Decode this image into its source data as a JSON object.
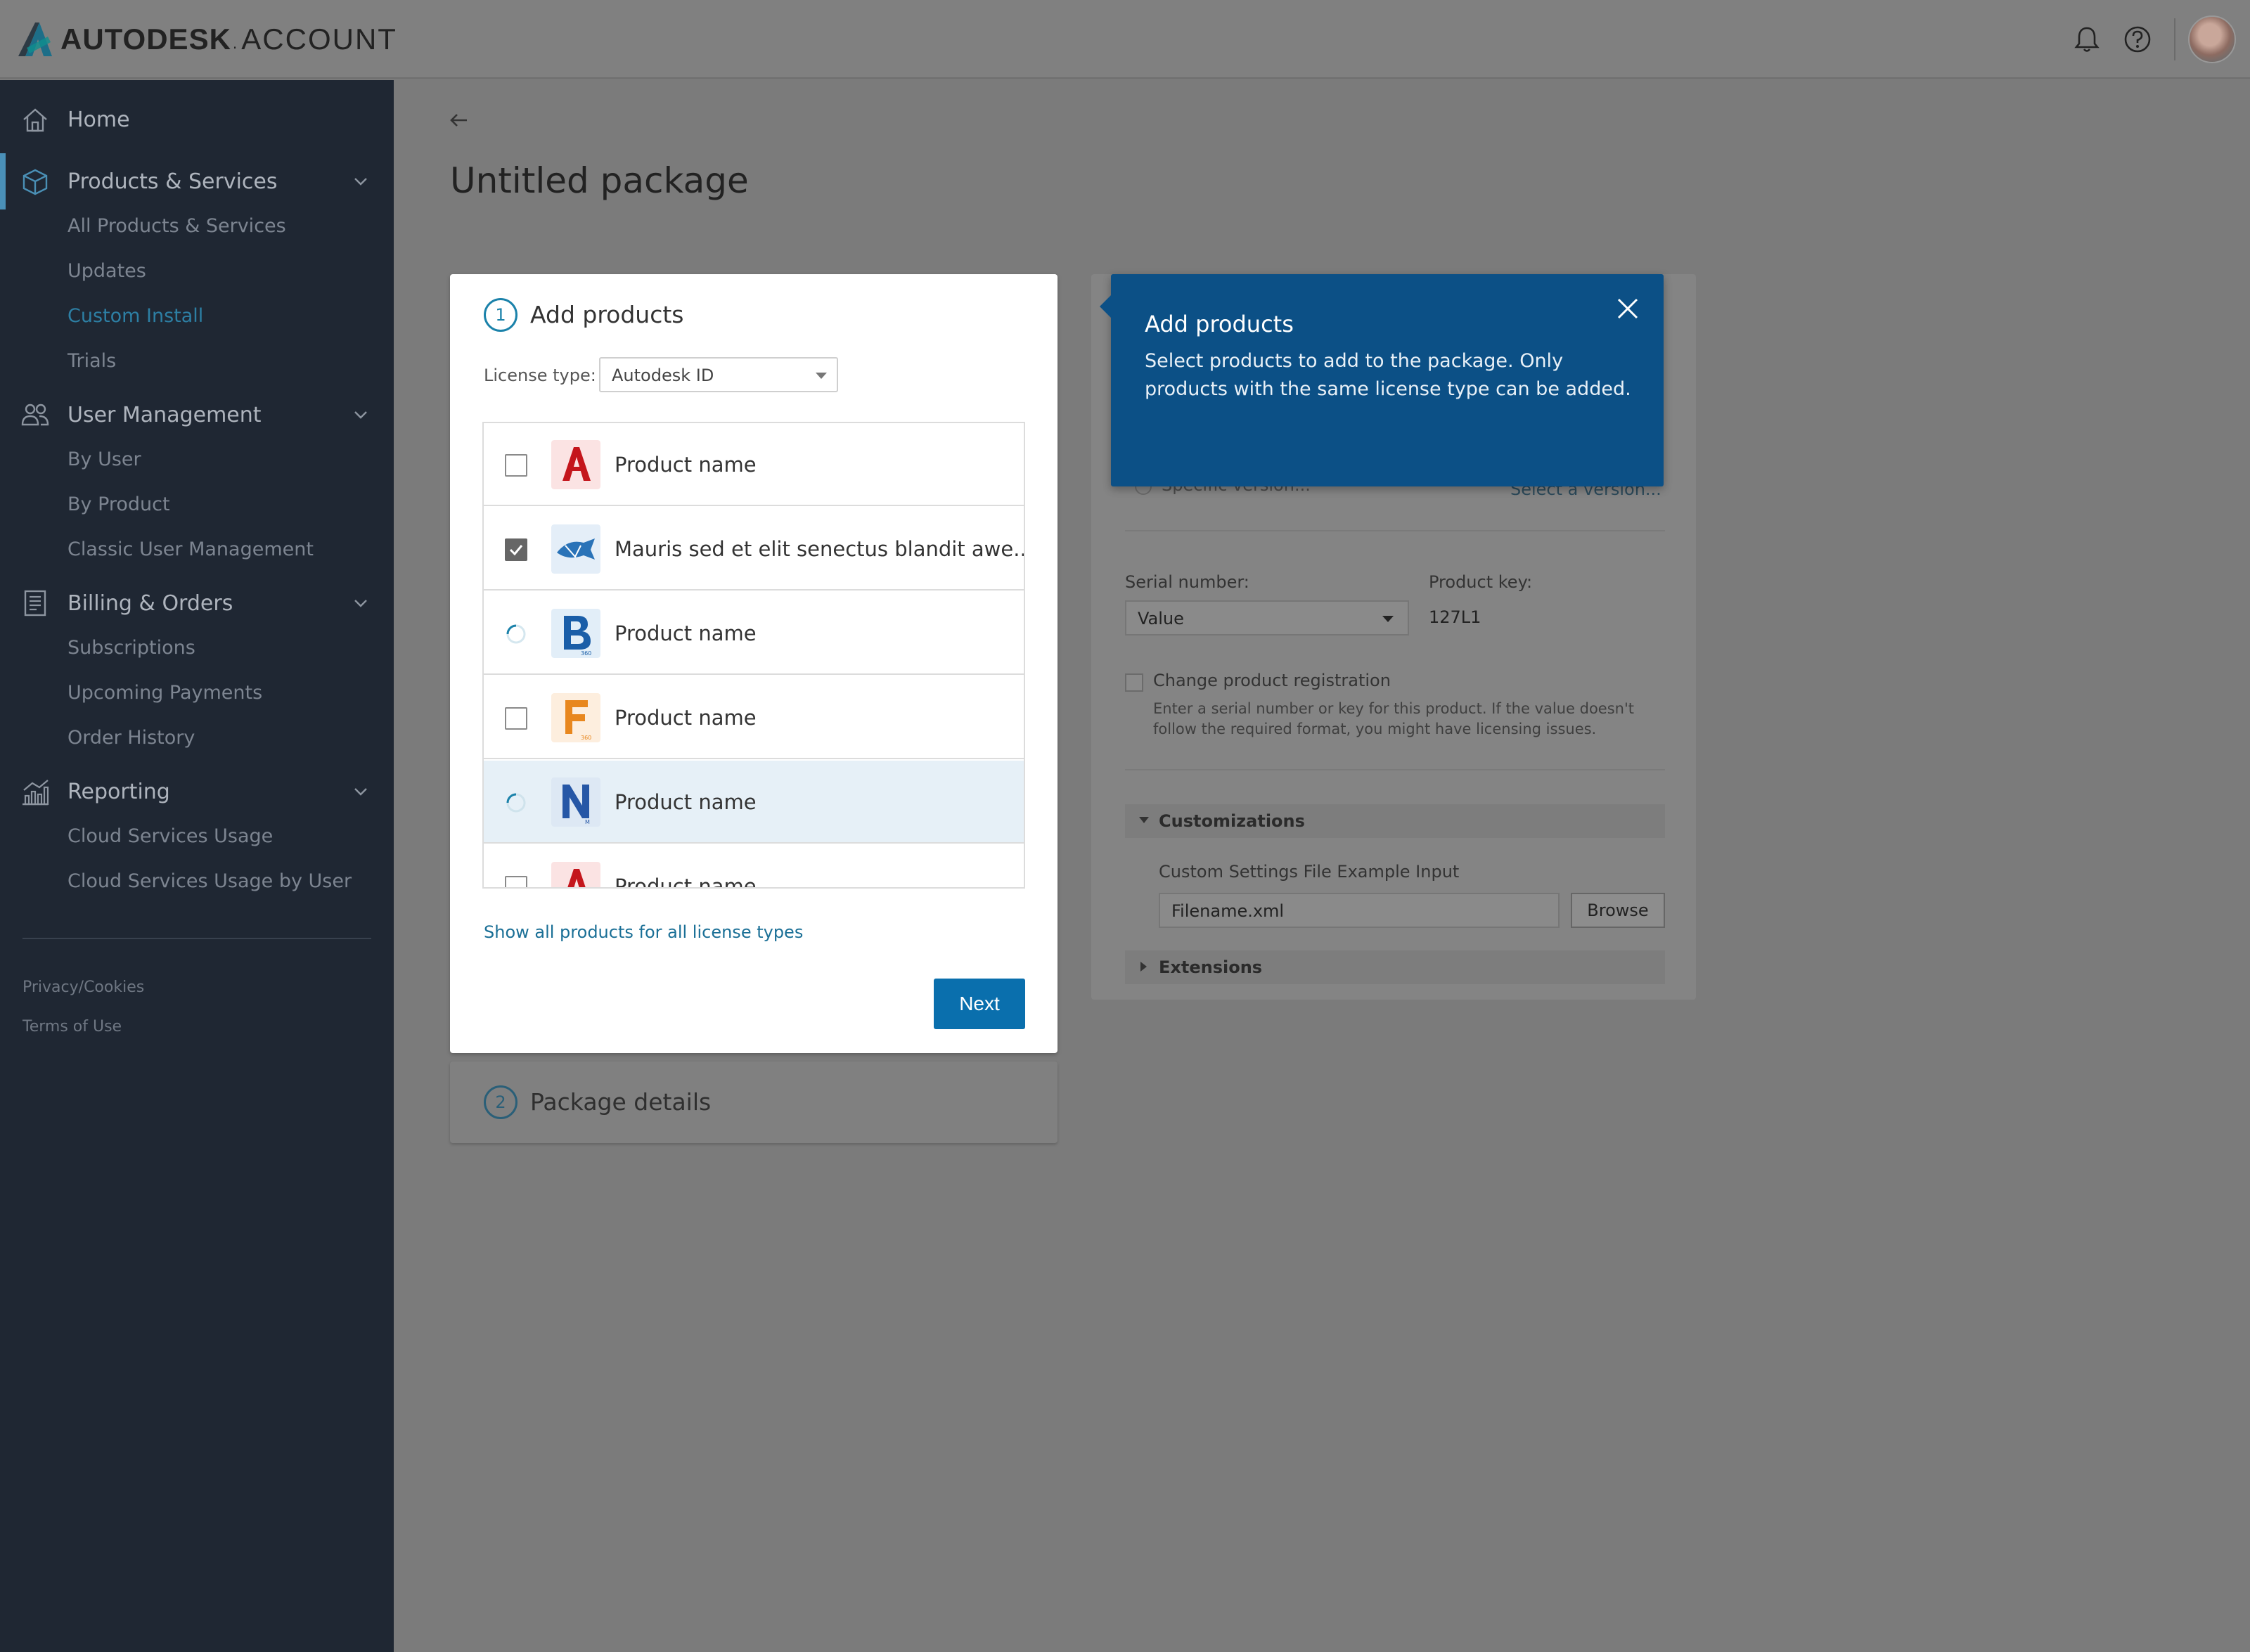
{
  "header": {
    "brand": "AUTODESK",
    "brand_dot": ".",
    "section": "ACCOUNT",
    "icons": [
      "autodesk-logo-icon",
      "bell-icon",
      "help-icon",
      "avatar"
    ]
  },
  "sidebar": {
    "home": "Home",
    "products_services": {
      "label": "Products & Services",
      "items": [
        "All Products & Services",
        "Updates",
        "Custom Install",
        "Trials"
      ],
      "current": "Custom Install"
    },
    "user_management": {
      "label": "User Management",
      "items": [
        "By User",
        "By Product",
        "Classic User Management"
      ]
    },
    "billing_orders": {
      "label": "Billing & Orders",
      "items": [
        "Subscriptions",
        "Upcoming Payments",
        "Order History"
      ]
    },
    "reporting": {
      "label": "Reporting",
      "items": [
        "Cloud Services Usage",
        "Cloud Services Usage by User"
      ]
    },
    "footer": [
      "Privacy/Cookies",
      "Terms of Use"
    ]
  },
  "main": {
    "page_title": "Untitled package",
    "add_products": {
      "step": "1",
      "title": "Add products",
      "license_label": "License type:",
      "license_value": "Autodesk ID",
      "products": [
        {
          "name": "Product name",
          "state": "unchecked",
          "icon": "autocad-icon"
        },
        {
          "name": "Mauris sed et elit senectus blandit awe...",
          "state": "checked",
          "icon": "navisworks-fish-icon"
        },
        {
          "name": "Product name",
          "state": "loading",
          "icon": "bim360-icon"
        },
        {
          "name": "Product name",
          "state": "unchecked",
          "icon": "fusion360-icon"
        },
        {
          "name": "Product name",
          "state": "loading",
          "icon": "navisworks-icon"
        },
        {
          "name": "Product name",
          "state": "unchecked",
          "icon": "autocad-icon"
        }
      ],
      "show_all": "Show all products for all license types",
      "next": "Next"
    },
    "package_details": {
      "step": "2",
      "title": "Package details"
    },
    "details_card": {
      "specific_version": "Specific version...",
      "select_version": "Select a version...",
      "serial_label": "Serial number:",
      "serial_value": "Value",
      "product_key_label": "Product key:",
      "product_key_value": "127L1",
      "change_registration": "Change product registration",
      "change_registration_help": "Enter a serial number or key for this product. If the value doesn't follow the required format, you might have licensing issues.",
      "customizations": "Customizations",
      "custom_settings_label": "Custom Settings File Example Input",
      "filename": "Filename.xml",
      "browse": "Browse",
      "extensions": "Extensions"
    },
    "tooltip": {
      "title": "Add products",
      "body": "Select products to add to the package. Only products with the same license type can be added."
    }
  }
}
